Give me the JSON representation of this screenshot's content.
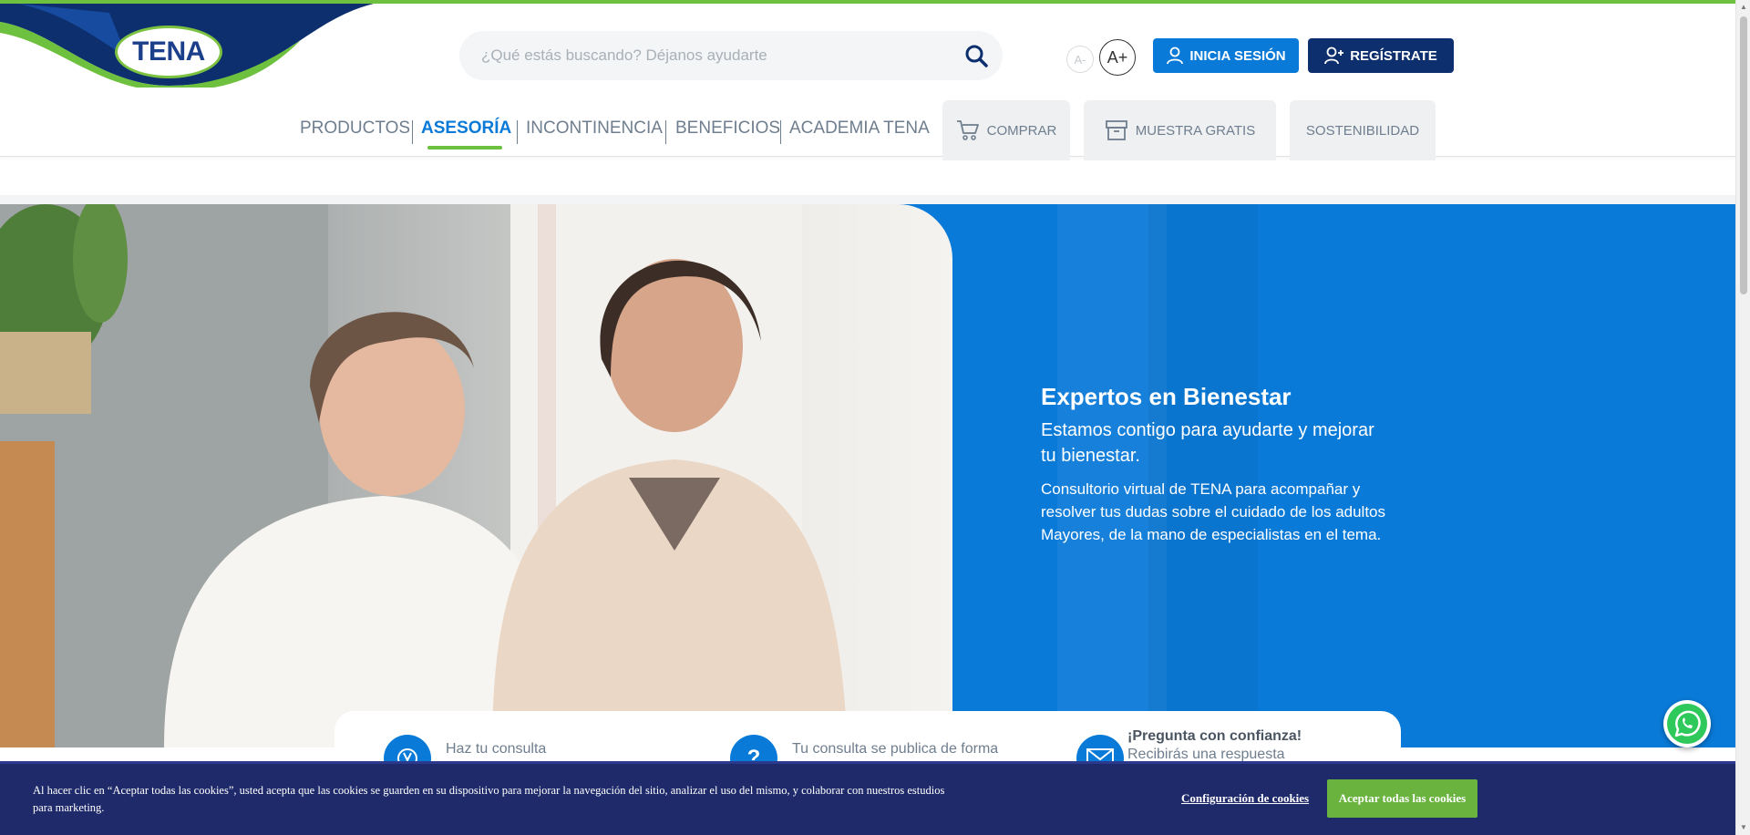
{
  "brand": {
    "logo_text": "TENA",
    "accent_green": "#6ec13e",
    "primary_blue": "#0a7ad8",
    "navy": "#0d2f6e"
  },
  "header": {
    "search": {
      "placeholder": "¿Qué estás buscando? Déjanos ayudarte",
      "icon": "search-icon"
    },
    "font_decrease": "A-",
    "font_increase": "A+",
    "login_label": "INICIA SESIÓN",
    "register_label": "REGÍSTRATE"
  },
  "nav": {
    "items": [
      {
        "label": "PRODUCTOS",
        "active": false
      },
      {
        "label": "ASESORÍA",
        "active": true
      },
      {
        "label": "INCONTINENCIA",
        "active": false
      },
      {
        "label": "BENEFICIOS",
        "active": false
      },
      {
        "label": "ACADEMIA TENA",
        "active": false
      }
    ],
    "tabs": [
      {
        "label": "COMPRAR",
        "icon": "cart-icon"
      },
      {
        "label": "MUESTRA GRATIS",
        "icon": "box-icon"
      },
      {
        "label": "SOSTENIBILIDAD",
        "icon": ""
      }
    ]
  },
  "hero": {
    "title": "Expertos en Bienestar",
    "subtitle": "Estamos contigo para ayudarte y mejorar tu bienestar.",
    "body": "Consultorio virtual de TENA para acompañar y resolver tus dudas sobre el cuidado de los adultos Mayores, de la mano de especialistas en el tema."
  },
  "info_cards": [
    {
      "text": "Haz tu consulta",
      "icon": "stethoscope-icon"
    },
    {
      "text": "Tu consulta se publica de forma",
      "icon": "question-icon"
    },
    {
      "title": "¡Pregunta con confianza!",
      "text": "Recibirás una respuesta",
      "icon": "mail-icon"
    }
  ],
  "cookie_banner": {
    "text": "Al hacer clic en “Aceptar todas las cookies”, usted acepta que las cookies se guarden en su dispositivo para mejorar la navegación del sitio, analizar el uso del mismo, y colaborar con nuestros estudios para marketing.",
    "settings_label": "Configuración de cookies",
    "accept_label": "Aceptar todas las cookies"
  }
}
